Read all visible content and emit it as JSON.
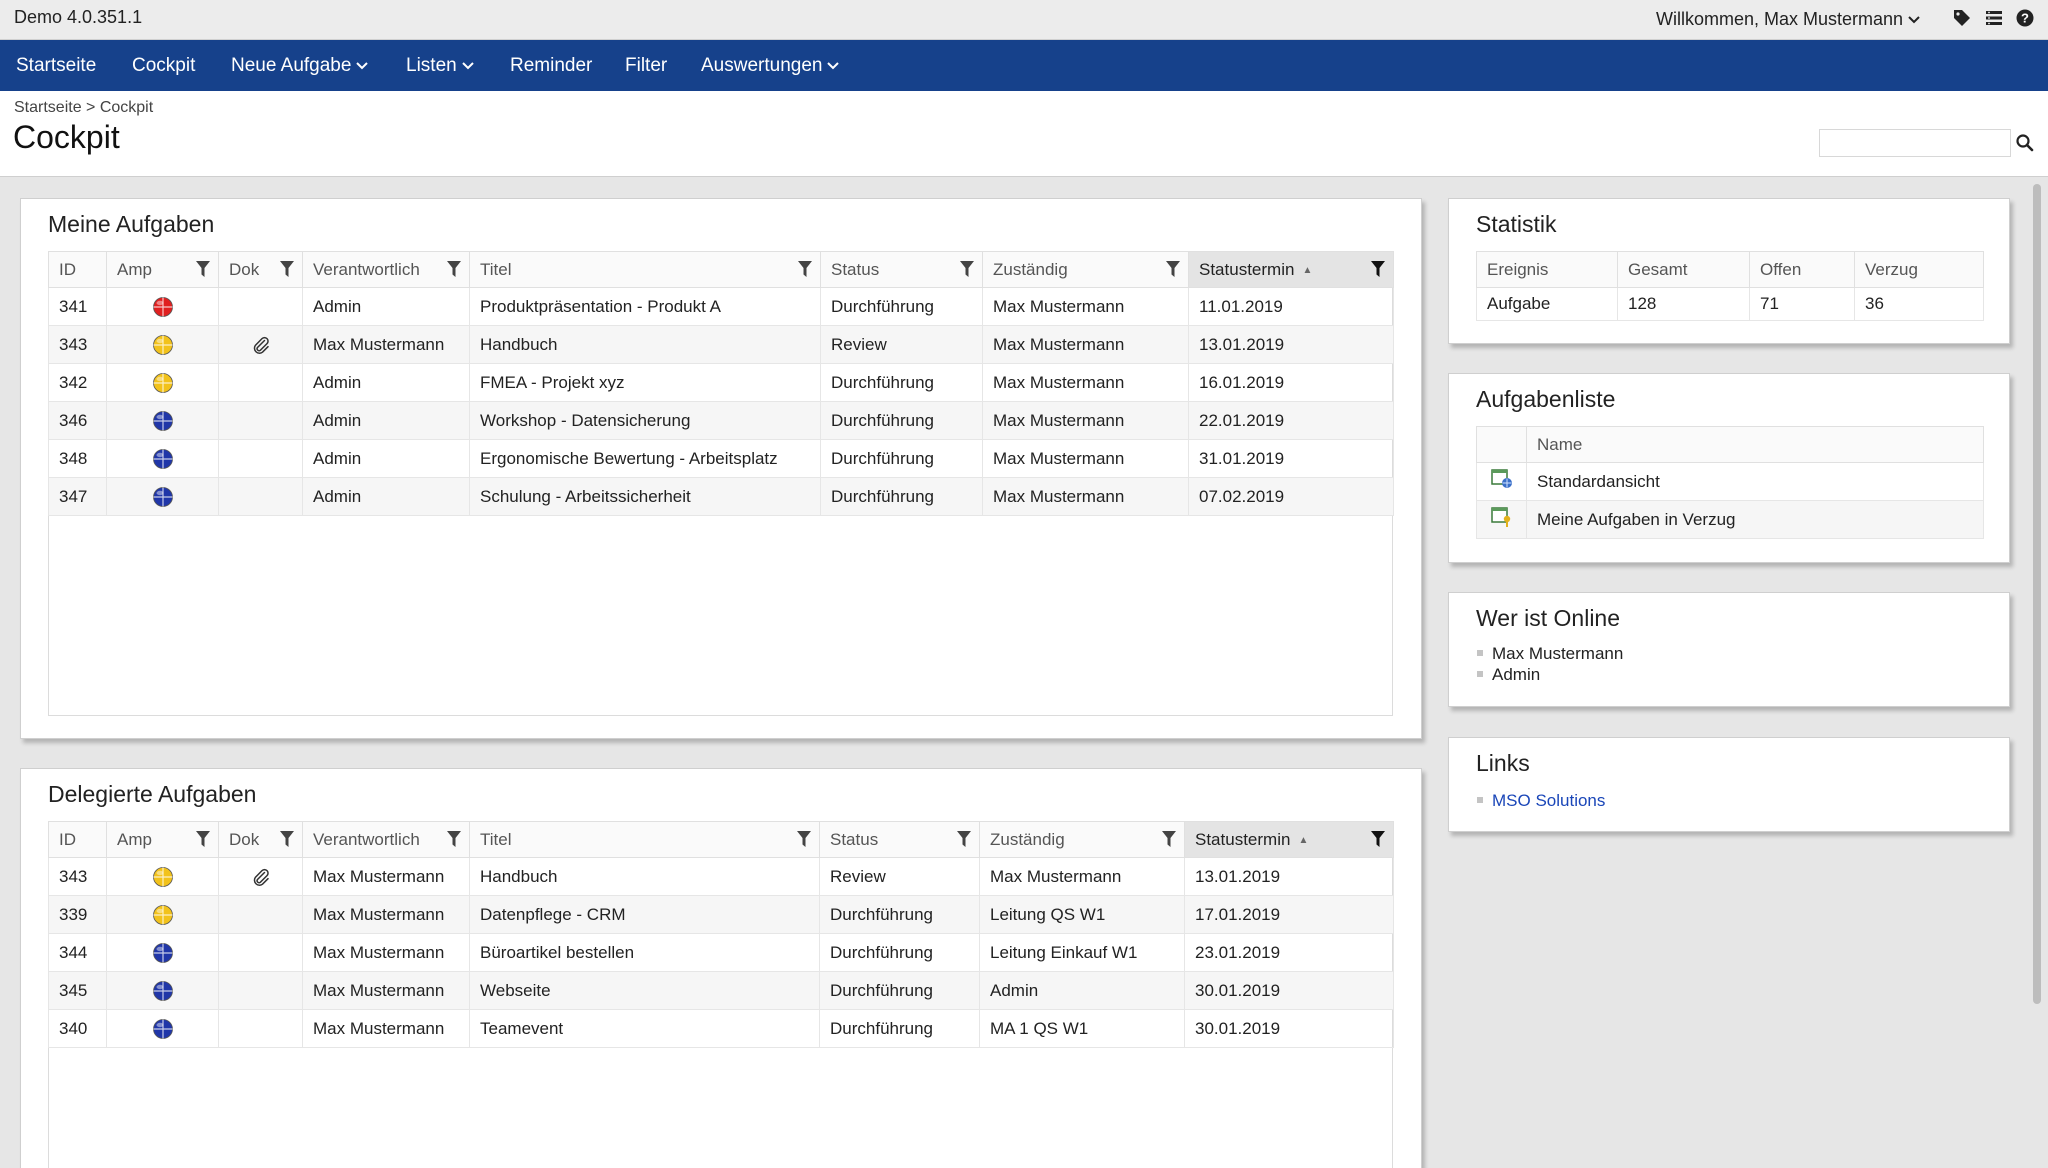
{
  "app": {
    "version": "Demo 4.0.351.1",
    "welcome": "Willkommen, Max Mustermann"
  },
  "topicons": [
    "tag-icon",
    "list-settings-icon",
    "help-icon"
  ],
  "nav": {
    "items": [
      {
        "label": "Startseite",
        "dropdown": false
      },
      {
        "label": "Cockpit",
        "dropdown": false
      },
      {
        "label": "Neue Aufgabe",
        "dropdown": true
      },
      {
        "label": "Listen",
        "dropdown": true
      },
      {
        "label": "Reminder",
        "dropdown": false
      },
      {
        "label": "Filter",
        "dropdown": false
      },
      {
        "label": "Auswertungen",
        "dropdown": true
      }
    ]
  },
  "breadcrumb": {
    "home": "Startseite",
    "separator": " > ",
    "current": "Cockpit"
  },
  "page": {
    "title": "Cockpit"
  },
  "search": {
    "placeholder": "",
    "value": ""
  },
  "colors": {
    "nav_bg": "#16418b",
    "amp_red": "#e02020",
    "amp_yellow": "#f2c21b",
    "amp_blue": "#2036a8",
    "link": "#1a46b8"
  },
  "meine_aufgaben": {
    "title": "Meine Aufgaben",
    "columns": [
      "ID",
      "Amp",
      "Dok",
      "Verantwortlich",
      "Titel",
      "Status",
      "Zuständig",
      "Statustermin"
    ],
    "rows": [
      {
        "id": "341",
        "amp": "red",
        "dok": false,
        "verantwortlich": "Admin",
        "titel": "Produktpräsentation - Produkt A",
        "status": "Durchführung",
        "zustaendig": "Max Mustermann",
        "termin": "11.01.2019"
      },
      {
        "id": "343",
        "amp": "yellow",
        "dok": true,
        "verantwortlich": "Max Mustermann",
        "titel": "Handbuch",
        "status": "Review",
        "zustaendig": "Max Mustermann",
        "termin": "13.01.2019"
      },
      {
        "id": "342",
        "amp": "yellow",
        "dok": false,
        "verantwortlich": "Admin",
        "titel": "FMEA - Projekt xyz",
        "status": "Durchführung",
        "zustaendig": "Max Mustermann",
        "termin": "16.01.2019"
      },
      {
        "id": "346",
        "amp": "blue",
        "dok": false,
        "verantwortlich": "Admin",
        "titel": "Workshop - Datensicherung",
        "status": "Durchführung",
        "zustaendig": "Max Mustermann",
        "termin": "22.01.2019"
      },
      {
        "id": "348",
        "amp": "blue",
        "dok": false,
        "verantwortlich": "Admin",
        "titel": "Ergonomische Bewertung - Arbeitsplatz",
        "status": "Durchführung",
        "zustaendig": "Max Mustermann",
        "termin": "31.01.2019"
      },
      {
        "id": "347",
        "amp": "blue",
        "dok": false,
        "verantwortlich": "Admin",
        "titel": "Schulung - Arbeitssicherheit",
        "status": "Durchführung",
        "zustaendig": "Max Mustermann",
        "termin": "07.02.2019"
      }
    ]
  },
  "delegierte_aufgaben": {
    "title": "Delegierte Aufgaben",
    "columns": [
      "ID",
      "Amp",
      "Dok",
      "Verantwortlich",
      "Titel",
      "Status",
      "Zuständig",
      "Statustermin"
    ],
    "rows": [
      {
        "id": "343",
        "amp": "yellow",
        "dok": true,
        "verantwortlich": "Max Mustermann",
        "titel": "Handbuch",
        "status": "Review",
        "zustaendig": "Max Mustermann",
        "termin": "13.01.2019"
      },
      {
        "id": "339",
        "amp": "yellow",
        "dok": false,
        "verantwortlich": "Max Mustermann",
        "titel": "Datenpflege - CRM",
        "status": "Durchführung",
        "zustaendig": "Leitung QS W1",
        "termin": "17.01.2019"
      },
      {
        "id": "344",
        "amp": "blue",
        "dok": false,
        "verantwortlich": "Max Mustermann",
        "titel": "Büroartikel bestellen",
        "status": "Durchführung",
        "zustaendig": "Leitung Einkauf W1",
        "termin": "23.01.2019"
      },
      {
        "id": "345",
        "amp": "blue",
        "dok": false,
        "verantwortlich": "Max Mustermann",
        "titel": "Webseite",
        "status": "Durchführung",
        "zustaendig": "Admin",
        "termin": "30.01.2019"
      },
      {
        "id": "340",
        "amp": "blue",
        "dok": false,
        "verantwortlich": "Max Mustermann",
        "titel": "Teamevent",
        "status": "Durchführung",
        "zustaendig": "MA 1 QS W1",
        "termin": "30.01.2019"
      }
    ]
  },
  "statistik": {
    "title": "Statistik",
    "columns": [
      "Ereignis",
      "Gesamt",
      "Offen",
      "Verzug"
    ],
    "rows": [
      {
        "ereignis": "Aufgabe",
        "gesamt": "128",
        "offen": "71",
        "verzug": "36"
      }
    ]
  },
  "aufgabenliste": {
    "title": "Aufgabenliste",
    "column": "Name",
    "rows": [
      {
        "name": "Standardansicht",
        "icon": "list-globe-icon"
      },
      {
        "name": "Meine Aufgaben in Verzug",
        "icon": "list-key-icon"
      }
    ]
  },
  "online": {
    "title": "Wer ist Online",
    "users": [
      "Max Mustermann",
      "Admin"
    ]
  },
  "links": {
    "title": "Links",
    "items": [
      "MSO Solutions"
    ]
  }
}
